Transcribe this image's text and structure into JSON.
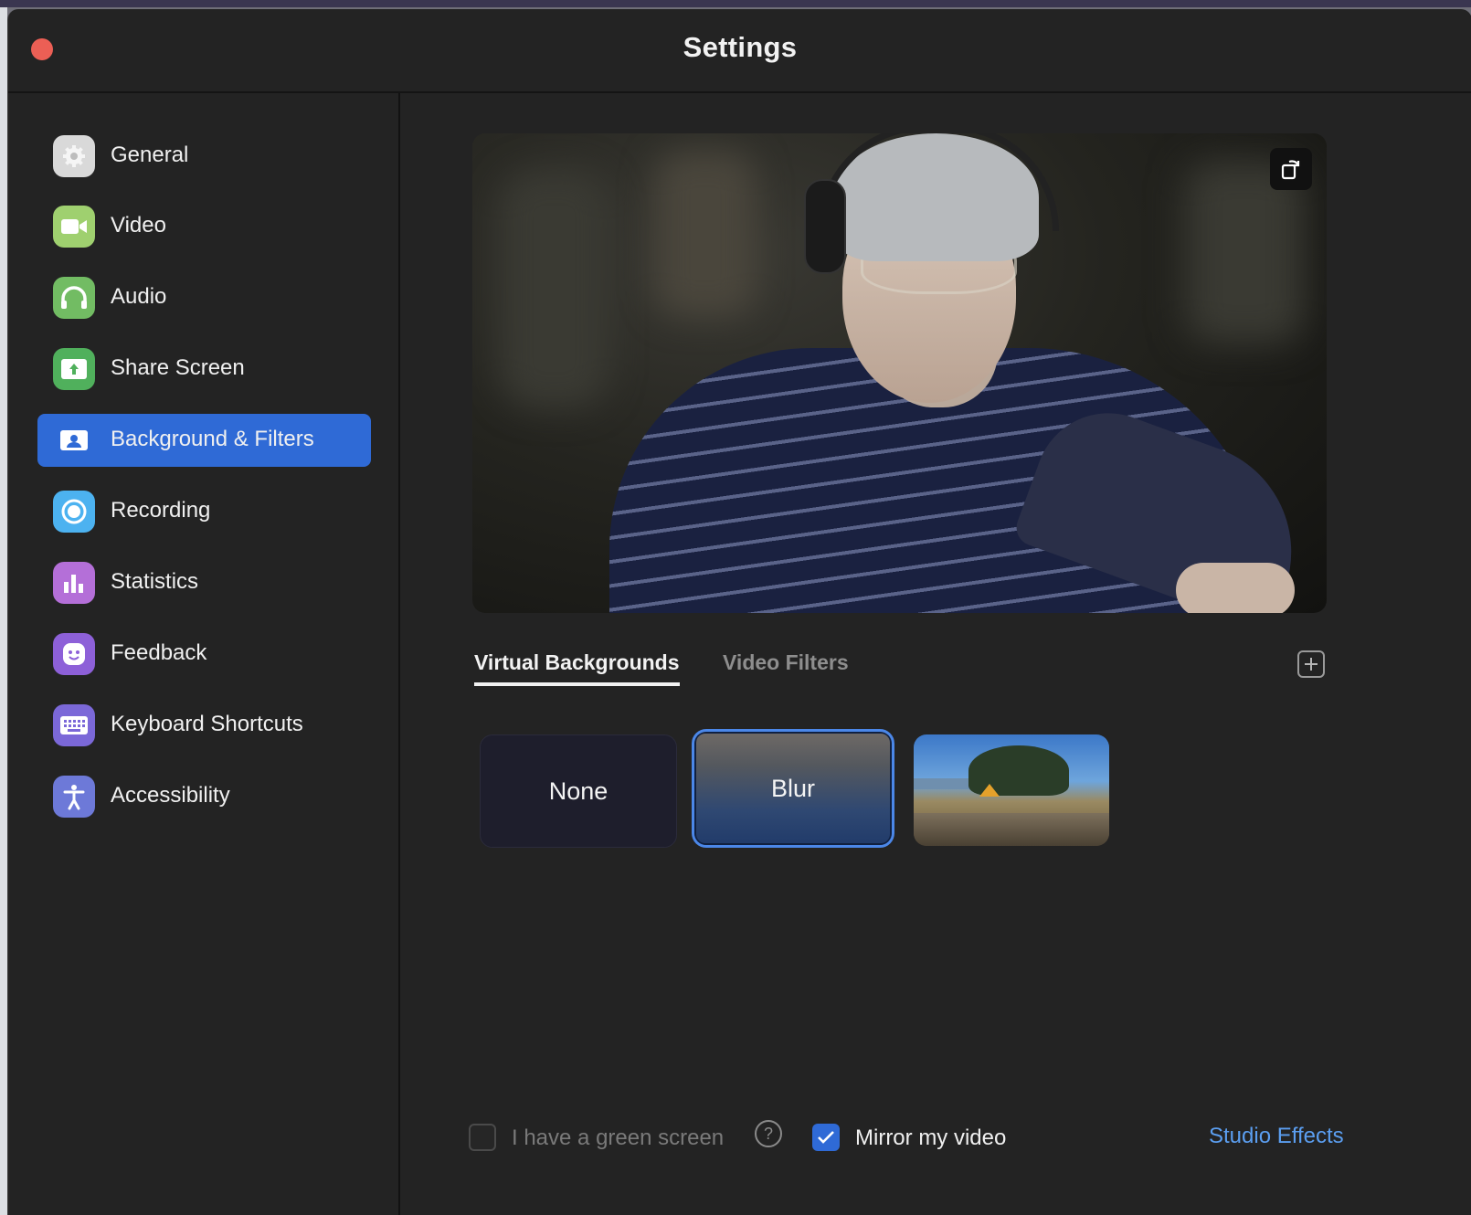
{
  "window": {
    "title": "Settings"
  },
  "colors": {
    "accent": "#2f6ad6",
    "link": "#5b9ef0",
    "close": "#ec5f55"
  },
  "sidebar": {
    "items": [
      {
        "label": "General",
        "icon": "gear-icon",
        "color": "#d9d9d9",
        "active": false
      },
      {
        "label": "Video",
        "icon": "video-camera-icon",
        "color": "#8fca67",
        "active": false
      },
      {
        "label": "Audio",
        "icon": "headphones-icon",
        "color": "#6fba5f",
        "active": false
      },
      {
        "label": "Share Screen",
        "icon": "share-screen-icon",
        "color": "#4fae5b",
        "active": false
      },
      {
        "label": "Background & Filters",
        "icon": "background-person-icon",
        "color": "#2f6ad6",
        "active": true
      },
      {
        "label": "Recording",
        "icon": "record-icon",
        "color": "#4cb2f0",
        "active": false
      },
      {
        "label": "Statistics",
        "icon": "bar-chart-icon",
        "color": "#b070d8",
        "active": false
      },
      {
        "label": "Feedback",
        "icon": "smiley-icon",
        "color": "#8a5fd8",
        "active": false
      },
      {
        "label": "Keyboard Shortcuts",
        "icon": "keyboard-icon",
        "color": "#7b6ad8",
        "active": false
      },
      {
        "label": "Accessibility",
        "icon": "accessibility-icon",
        "color": "#6f7ad8",
        "active": false
      }
    ]
  },
  "main": {
    "tabs": [
      {
        "label": "Virtual Backgrounds",
        "active": true
      },
      {
        "label": "Video Filters",
        "active": false
      }
    ],
    "backgrounds": [
      {
        "label": "None",
        "selected": false
      },
      {
        "label": "Blur",
        "selected": true
      },
      {
        "label": "",
        "selected": false
      }
    ],
    "green_screen": {
      "label": "I have a green screen",
      "checked": false
    },
    "mirror": {
      "label": "Mirror my video",
      "checked": true
    },
    "studio_effects": "Studio Effects"
  }
}
